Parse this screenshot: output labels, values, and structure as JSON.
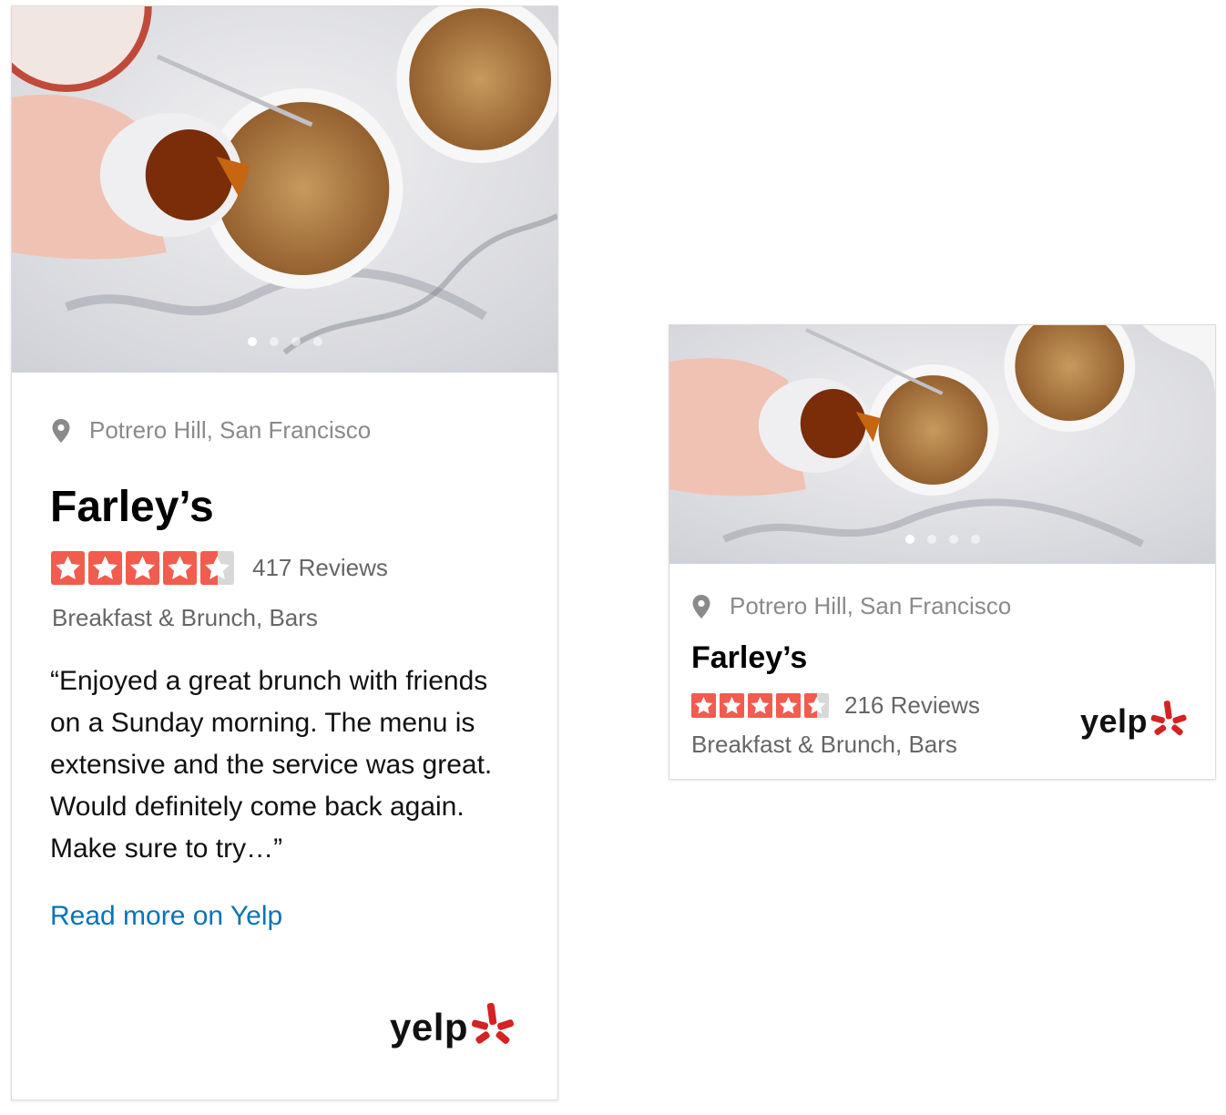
{
  "carousel": {
    "dot_count": 4,
    "active_index": 0
  },
  "colors": {
    "star_red": "#f15c4f",
    "star_empty": "#d8d8d8",
    "yelp_red": "#d32323",
    "link_blue": "#0b73b7"
  },
  "cards": [
    {
      "location": "Potrero Hill, San Francisco",
      "name": "Farley’s",
      "rating": 4.5,
      "reviews": "417 Reviews",
      "categories": "Breakfast & Brunch, Bars",
      "quote": "“Enjoyed a great brunch with friends on a Sunday morning. The menu is extensive and the service was great. Would definitely come back again. Make sure to try…”",
      "read_more": "Read more on Yelp",
      "logo_text": "yelp"
    },
    {
      "location": "Potrero Hill, San Francisco",
      "name": "Farley’s",
      "rating": 4.5,
      "reviews": "216 Reviews",
      "categories": "Breakfast & Brunch, Bars",
      "logo_text": "yelp"
    }
  ]
}
